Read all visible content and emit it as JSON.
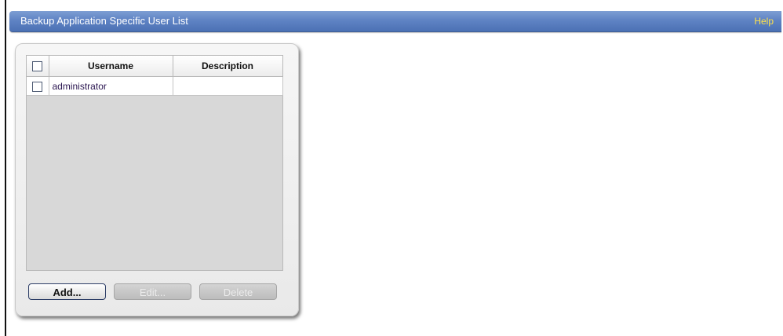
{
  "header": {
    "title": "Backup Application Specific User List",
    "help_label": "Help"
  },
  "table": {
    "columns": [
      "Username",
      "Description"
    ],
    "rows": [
      {
        "username": "administrator",
        "description": ""
      }
    ]
  },
  "buttons": {
    "add_label": "Add...",
    "edit_label": "Edit...",
    "delete_label": "Delete"
  },
  "colors": {
    "header_bar": "#5f83c4",
    "help_link": "#ffe14a",
    "panel_background": "#ececec",
    "table_background": "#d8d8d8",
    "disabled_button": "#c8c8c8"
  }
}
